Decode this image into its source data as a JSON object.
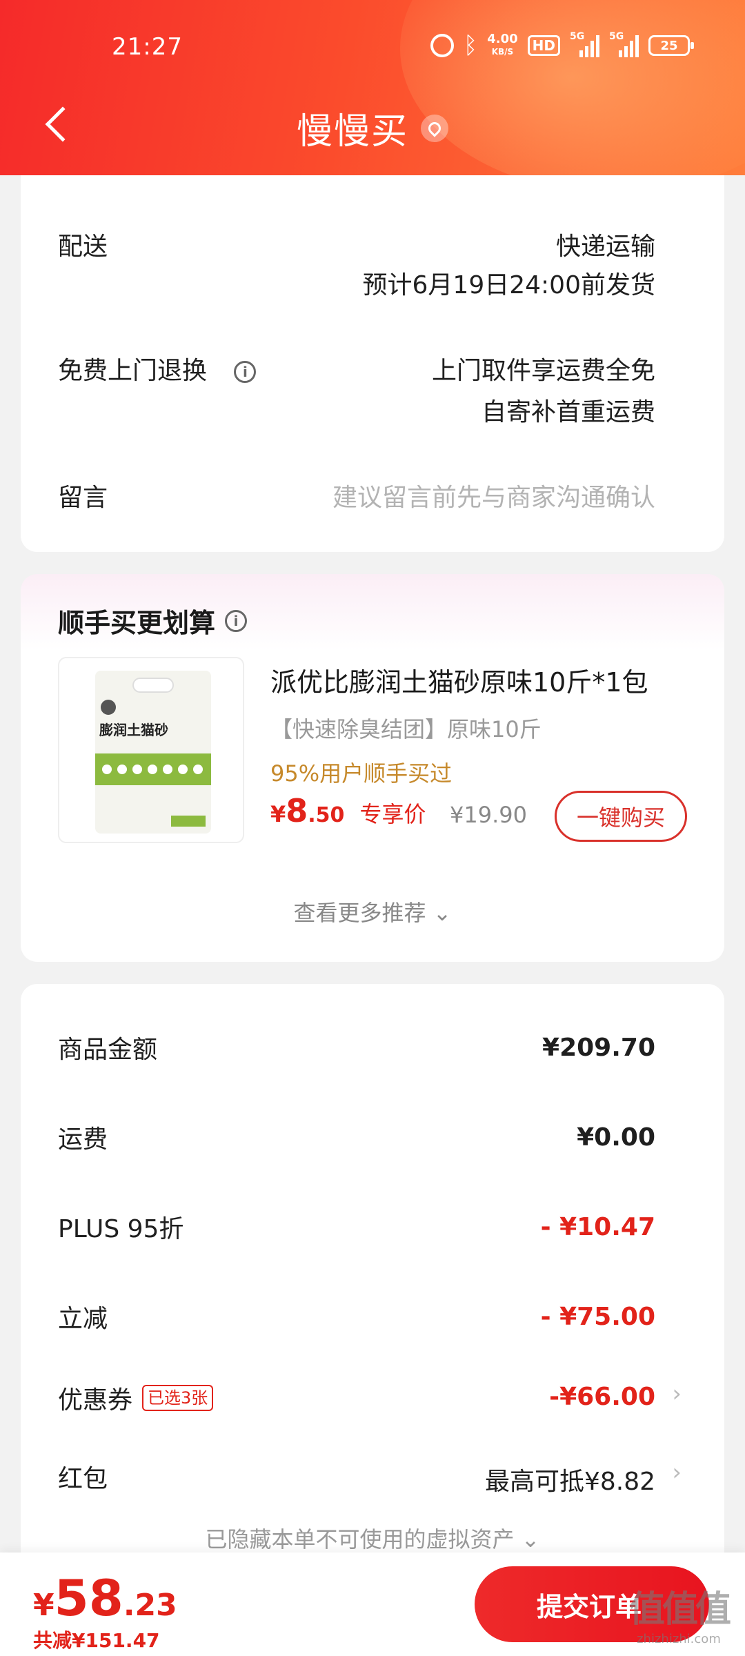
{
  "status_bar": {
    "time": "21:27",
    "net_speed_value": "4.00",
    "net_speed_unit": "KB/S",
    "hd_label": "HD",
    "signal1_label": "5G",
    "signal2_label": "5G",
    "battery": "25"
  },
  "nav": {
    "title": "慢慢买"
  },
  "delivery": {
    "shipping_label": "配送",
    "shipping_method": "快递运输",
    "shipping_eta": "预计6月19日24:00前发货",
    "return_label": "免费上门退换",
    "return_line1": "上门取件享运费全免",
    "return_line2": "自寄补首重运费",
    "message_label": "留言",
    "message_placeholder": "建议留言前先与商家沟通确认"
  },
  "addon": {
    "title": "顺手买更划算",
    "image_title": "膨润土猫砂",
    "product_name": "派优比膨润土猫砂原味10斤*1包",
    "product_spec": "【快速除臭结团】原味10斤",
    "product_note": "95%用户顺手买过",
    "price_symbol": "¥",
    "price_int": "8",
    "price_dec": ".50",
    "price_label": "专享价",
    "original_price": "¥19.90",
    "buy_button": "一键购买",
    "more_link": "查看更多推荐 ⌄"
  },
  "amounts": {
    "goods_label": "商品金额",
    "goods_value": "¥209.70",
    "freight_label": "运费",
    "freight_value": "¥0.00",
    "plus_label": "PLUS 95折",
    "plus_value": "- ¥10.47",
    "instant_label": "立减",
    "instant_value": "- ¥75.00",
    "coupon_label": "优惠券",
    "coupon_badge": "已选3张",
    "coupon_value": "-¥66.00",
    "redpacket_label": "红包",
    "redpacket_value": "最高可抵¥8.82",
    "hidden_note": "已隐藏本单不可使用的虚拟资产 ⌄"
  },
  "footer": {
    "total_symbol": "¥",
    "total_int": "58",
    "total_dec": ".23",
    "saved": "共减¥151.47",
    "submit": "提交订单",
    "watermark_logo": "值值值",
    "watermark_url": "zhizhizhi.com"
  },
  "colors": {
    "accent_red": "#e2231a",
    "note_orange": "#c6892b",
    "header_gradient_start": "#f52a2a",
    "header_gradient_end": "#ff7d3b"
  },
  "icons": [
    "back-icon",
    "location-pin-icon",
    "info-icon",
    "chevron-right-icon",
    "alarm-icon",
    "bluetooth-icon",
    "battery-icon"
  ]
}
